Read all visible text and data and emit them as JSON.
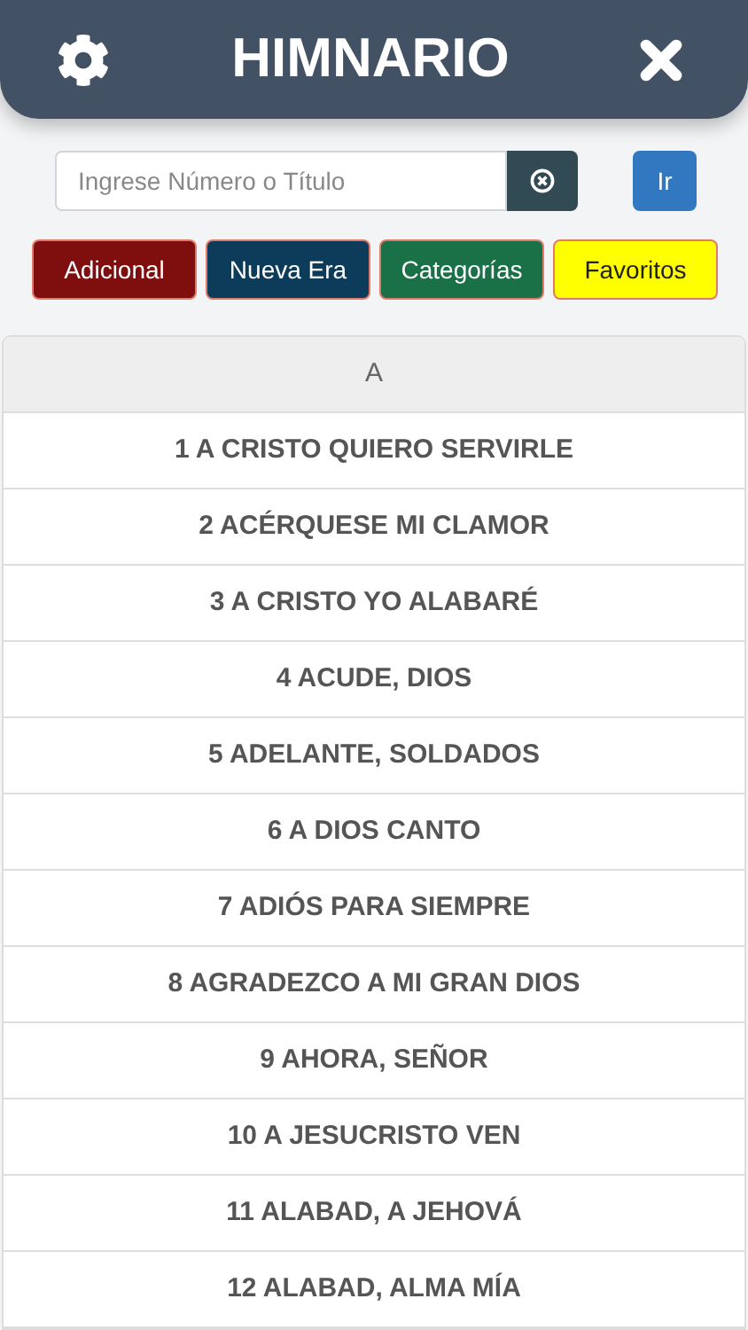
{
  "header": {
    "title": "HIMNARIO"
  },
  "search": {
    "placeholder": "Ingrese Número o Título",
    "go_button": "Ir"
  },
  "categories": [
    {
      "label": "Adicional",
      "color": "#7f0e0e",
      "dark_text": false
    },
    {
      "label": "Nueva Era",
      "color": "#0d3b5a",
      "dark_text": false
    },
    {
      "label": "Categorías",
      "color": "#1a7148",
      "dark_text": false
    },
    {
      "label": "Favoritos",
      "color": "#ffff00",
      "dark_text": true
    }
  ],
  "list": {
    "section": "A",
    "items": [
      "1 A CRISTO QUIERO SERVIRLE",
      "2 ACÉRQUESE MI CLAMOR",
      "3 A CRISTO YO ALABARÉ",
      "4 ACUDE, DIOS",
      "5 ADELANTE, SOLDADOS",
      "6 A DIOS CANTO",
      "7 ADIÓS PARA SIEMPRE",
      "8 AGRADEZCO A MI GRAN DIOS",
      "9 AHORA, SEÑOR",
      "10 A JESUCRISTO VEN",
      "11 ALABAD, A JEHOVÁ",
      "12 ALABAD, ALMA MÍA"
    ]
  }
}
